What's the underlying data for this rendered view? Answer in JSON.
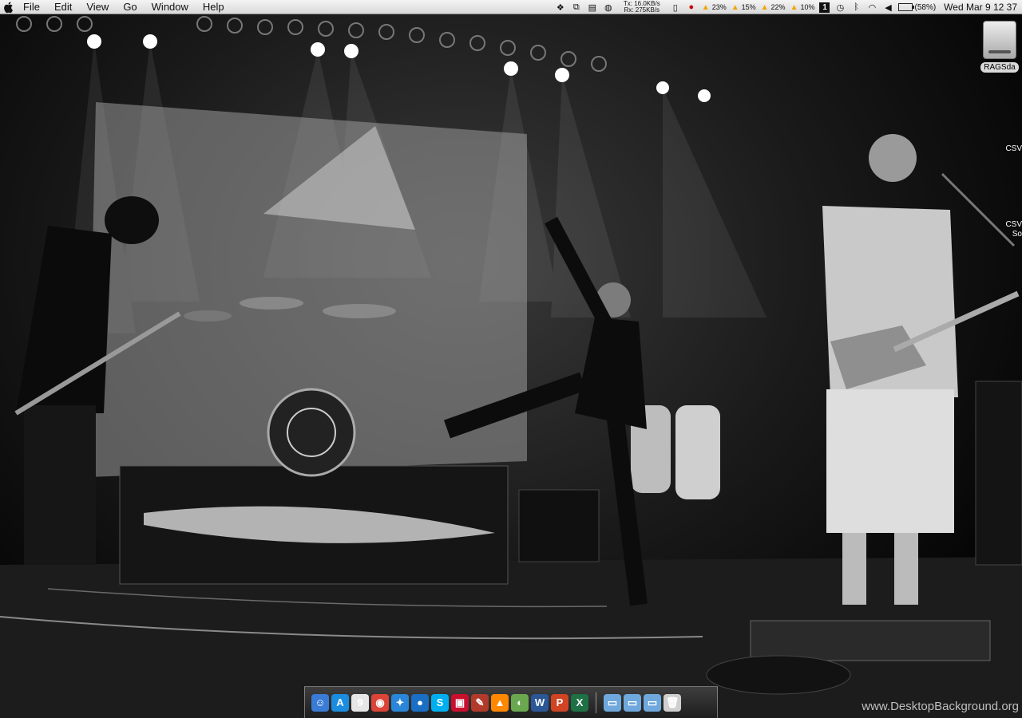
{
  "menubar": {
    "menus": [
      "File",
      "Edit",
      "View",
      "Go",
      "Window",
      "Help"
    ],
    "network": {
      "tx": "Tx:  16.0KB/s",
      "rx": "Rx:  275KB/s"
    },
    "cpu_loads": [
      "23%",
      "15%",
      "22%",
      "10%"
    ],
    "space_number": "1",
    "battery": "(58%)",
    "battery_level": 0.58,
    "clock": "Wed Mar 9  12 37"
  },
  "desktop": {
    "disk_label": "RAGSda",
    "labels": [
      "CSV",
      "CSV\nSo"
    ]
  },
  "dock": {
    "apps": [
      {
        "icon": "finder-icon",
        "glyph": "☺",
        "color": "#3a7bd5"
      },
      {
        "icon": "app-store-icon",
        "glyph": "A",
        "color": "#1b8de0"
      },
      {
        "icon": "calendar-icon",
        "glyph": "9",
        "color": "#e6e6e6"
      },
      {
        "icon": "chrome-icon",
        "glyph": "◉",
        "color": "#db4437"
      },
      {
        "icon": "safari-icon",
        "glyph": "✦",
        "color": "#2a86d8"
      },
      {
        "icon": "messages-icon",
        "glyph": "●",
        "color": "#1a6fc4"
      },
      {
        "icon": "skype-icon",
        "glyph": "S",
        "color": "#00aff0"
      },
      {
        "icon": "parallels-icon",
        "glyph": "▣",
        "color": "#c8102e"
      },
      {
        "icon": "automator-icon",
        "glyph": "✎",
        "color": "#b23a2b"
      },
      {
        "icon": "vlc-icon",
        "glyph": "▲",
        "color": "#ff8800"
      },
      {
        "icon": "picasa-icon",
        "glyph": "◐",
        "color": "#6aa84f"
      },
      {
        "icon": "word-icon",
        "glyph": "W",
        "color": "#2b5797"
      },
      {
        "icon": "powerpoint-icon",
        "glyph": "P",
        "color": "#d04423"
      },
      {
        "icon": "excel-icon",
        "glyph": "X",
        "color": "#1e7145"
      }
    ],
    "folders": [
      {
        "icon": "applications-folder-icon",
        "glyph": "▭",
        "color": "#6fa8dc"
      },
      {
        "icon": "documents-folder-icon",
        "glyph": "▭",
        "color": "#6fa8dc"
      },
      {
        "icon": "downloads-folder-icon",
        "glyph": "▭",
        "color": "#6fa8dc"
      },
      {
        "icon": "trash-icon",
        "glyph": "🗑",
        "color": "#cfcfcf"
      }
    ]
  },
  "watermark": "www.DesktopBackground.org"
}
